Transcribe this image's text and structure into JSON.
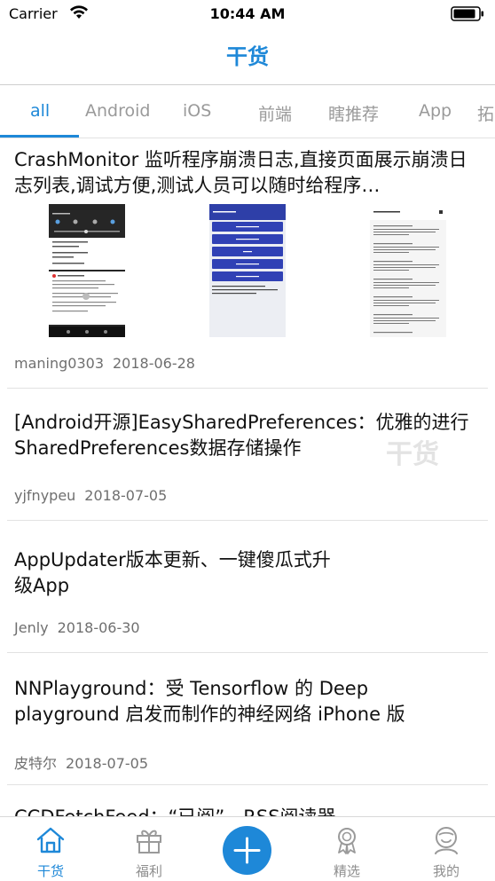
{
  "status_bar": {
    "carrier": "Carrier",
    "time": "10:44 AM"
  },
  "nav": {
    "title": "干货"
  },
  "tabs": [
    {
      "label": "all",
      "active": true
    },
    {
      "label": "Android"
    },
    {
      "label": "iOS"
    },
    {
      "label": "前端"
    },
    {
      "label": "瞎推荐"
    },
    {
      "label": "App"
    },
    {
      "label": "拓"
    }
  ],
  "feed": [
    {
      "title": "CrashMonitor 监听程序崩溃日志,直接页面展示崩溃日志列表,调试方便,测试人员可以随时给程序…",
      "author": "maning0303",
      "date": "2018-06-28",
      "has_images": true
    },
    {
      "title": "[Android开源]EasySharedPreferences：优雅的进行SharedPreferences数据存储操作",
      "author": "yjfnypeu",
      "date": "2018-07-05"
    },
    {
      "title": "AppUpdater版本更新、一键傻瓜式升级App",
      "author": "Jenly",
      "date": "2018-06-30"
    },
    {
      "title": "NNPlayground：受 Tensorflow 的 Deep playground 启发而制作的神经网络 iPhone 版",
      "author": "皮特尔",
      "date": "2018-07-05"
    },
    {
      "title": "CCDFetchFeed：“已阅”，RSS阅读器"
    }
  ],
  "watermark": "干货",
  "tabbar": [
    {
      "label": "干货",
      "icon": "home-icon",
      "active": true
    },
    {
      "label": "福利",
      "icon": "gift-icon"
    },
    {
      "label": "",
      "icon": "plus-icon"
    },
    {
      "label": "精选",
      "icon": "award-icon"
    },
    {
      "label": "我的",
      "icon": "profile-icon"
    }
  ],
  "colors": {
    "accent": "#1e88d8",
    "meta": "#6f6f6f",
    "inactive": "#9a9a9a"
  }
}
